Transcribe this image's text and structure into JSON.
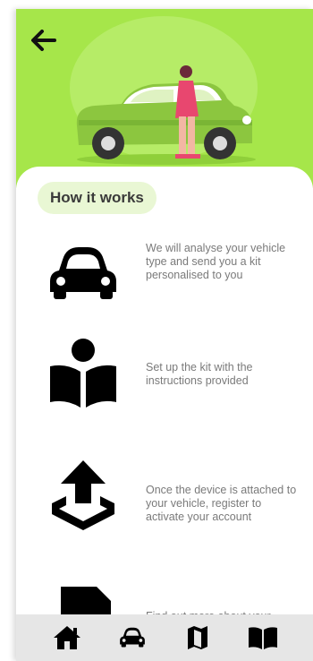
{
  "header": {
    "back_icon": "arrow-left-icon",
    "accent": "#a6e64a"
  },
  "section": {
    "title": "How it works"
  },
  "steps": [
    {
      "icon": "car-icon",
      "text": "We will analyse your vehicle type and send you a kit personalised to you"
    },
    {
      "icon": "reader-book-icon",
      "text": "Set up the kit with the instructions provided"
    },
    {
      "icon": "upload-box-icon",
      "text": "Once the device is attached to your vehicle, register to activate your account"
    },
    {
      "icon": "file-search-icon",
      "text": "Find out more about your"
    }
  ],
  "bottom_nav": [
    {
      "icon": "home-icon"
    },
    {
      "icon": "car-icon"
    },
    {
      "icon": "map-icon"
    },
    {
      "icon": "book-icon"
    }
  ]
}
